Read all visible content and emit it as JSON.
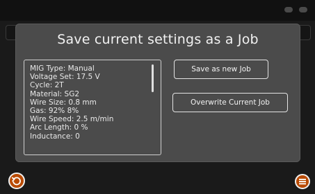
{
  "dialog": {
    "title": "Save current settings as a Job",
    "settings": [
      "MIG Type: Manual",
      "Voltage Set: 17.5 V",
      "Cycle: 2T",
      "Material: SG2",
      "Wire Size: 0.8 mm",
      "Gas: 92% 8%",
      "Wire Speed: 2.5 m/min",
      "Arc Length: 0 %",
      "Inductance: 0"
    ],
    "save_new_label": "Save as new Job",
    "overwrite_label": "Overwrite Current Job"
  },
  "icons": {
    "back": "undo-arrow-icon",
    "menu": "menu-lines-icon"
  },
  "colors": {
    "accent": "#b94a00",
    "dialog_bg": "#4b4b4b",
    "screen_bg": "#1a1a1a"
  }
}
